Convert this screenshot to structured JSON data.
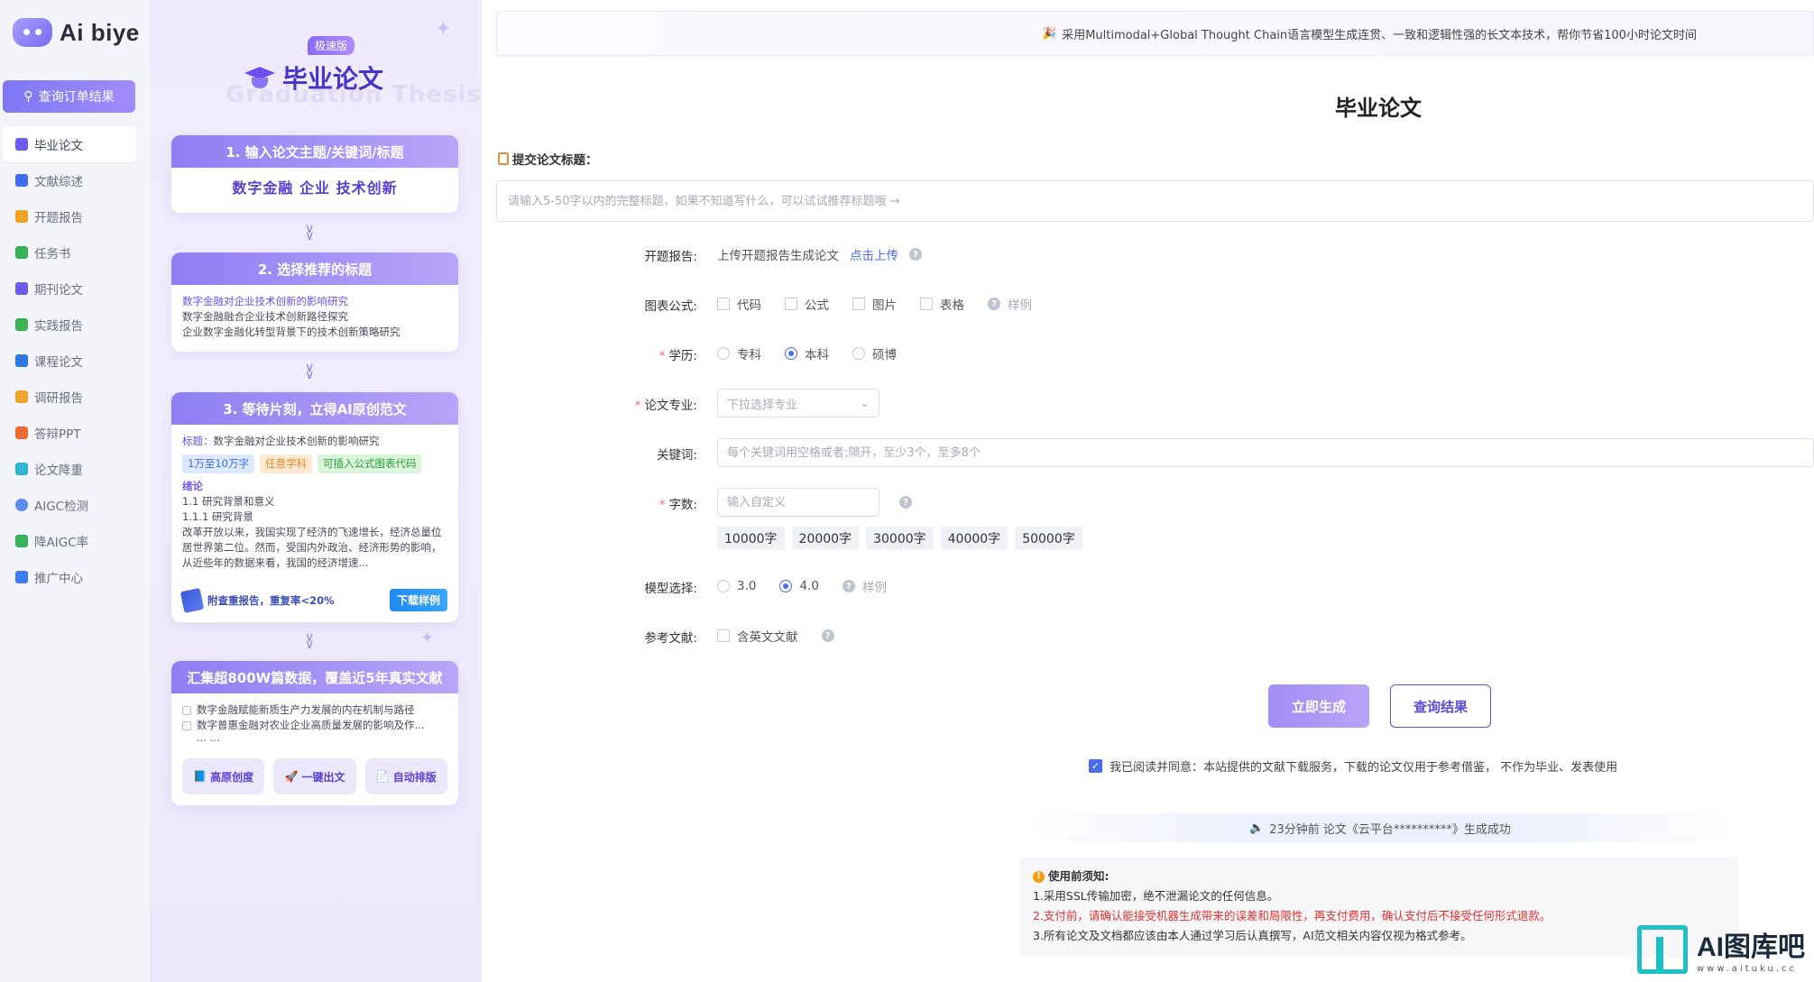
{
  "sidebar": {
    "logo": "Ai biye",
    "order_button": "查询订单结果",
    "items": [
      {
        "label": "毕业论文",
        "color": "#6a5cf0",
        "active": true
      },
      {
        "label": "文献综述",
        "color": "#3c6ff0"
      },
      {
        "label": "开题报告",
        "color": "#f3a21e"
      },
      {
        "label": "任务书",
        "color": "#33b45a"
      },
      {
        "label": "期刊论文",
        "color": "#6a5cf0"
      },
      {
        "label": "实践报告",
        "color": "#3bb552"
      },
      {
        "label": "课程论文",
        "color": "#2f77e0"
      },
      {
        "label": "调研报告",
        "color": "#f2a32b"
      },
      {
        "label": "答辩PPT",
        "color": "#f06a32"
      },
      {
        "label": "论文降重",
        "color": "#2fb6d6"
      },
      {
        "label": "AIGC检测",
        "color": "#5b8af0"
      },
      {
        "label": "降AIGC率",
        "color": "#33b45a"
      },
      {
        "label": "推广中心",
        "color": "#3c7ef0"
      }
    ]
  },
  "promo": {
    "badge": "极速版",
    "title": "毕业论文",
    "ghost": "Graduation Thesis",
    "step1": {
      "head": "1. 输入论文主题/关键词/标题",
      "body": "数字金融 企业 技术创新"
    },
    "step2": {
      "head": "2. 选择推荐的标题",
      "lines": [
        "数字金融对企业技术创新的影响研究",
        "数字金融融合企业技术创新路径探究",
        "企业数字金融化转型背景下的技术创新策略研究"
      ]
    },
    "step3": {
      "head": "3. 等待片刻，立得AI原创范文",
      "title_label": "标题：",
      "title_value": "数字金融对企业技术创新的影响研究",
      "tags": [
        "1万至10万字",
        "任意学科",
        "可插入公式图表代码"
      ],
      "section": "绪论",
      "outline": [
        "1.1 研究背景和意义",
        "1.1.1 研究背景"
      ],
      "paragraph": "改革开放以来，我国实现了经济的飞速增长，经济总量位居世界第二位。然而，受国内外政治、经济形势的影响，从近些年的数据来看，我国的经济增速...",
      "report_text": "附查重报告，重复率<20%",
      "download": "下载样例"
    },
    "step4": {
      "head": "汇集超800W篇数据，覆盖近5年真实文献",
      "items": [
        "数字金融赋能新质生产力发展的内在机制与路径",
        "数字普惠金融对农业企业高质量发展的影响及作..."
      ],
      "ellipsis": "... ...",
      "features": [
        "高原创度",
        "一键出文",
        "自动排版"
      ]
    }
  },
  "main": {
    "banner": "采用Multimodal+Global Thought Chain语言模型生成连贯、一致和逻辑性强的长文本技术，帮你节省100小时论文时间",
    "title": "毕业论文",
    "section_title": "提交论文标题：",
    "title_placeholder": "请输入5-50字以内的完整标题，如果不知道写什么，可以试试推荐标题哦 →",
    "proposal": {
      "label": "开题报告:",
      "text": "上传开题报告生成论文",
      "link": "点击上传"
    },
    "figures": {
      "label": "图表公式:",
      "options": [
        "代码",
        "公式",
        "图片",
        "表格"
      ],
      "sample": "样例"
    },
    "degree": {
      "label": "学历:",
      "options": [
        "专科",
        "本科",
        "硕博"
      ],
      "selected": 1
    },
    "major": {
      "label": "论文专业:",
      "placeholder": "下拉选择专业"
    },
    "keywords": {
      "label": "关键词:",
      "placeholder": "每个关键词用空格或者;隔开，至少3个，至多8个"
    },
    "wordcount": {
      "label": "字数:",
      "placeholder": "输入自定义",
      "chips": [
        "10000字",
        "20000字",
        "30000字",
        "40000字",
        "50000字"
      ]
    },
    "model": {
      "label": "模型选择:",
      "options": [
        "3.0",
        "4.0"
      ],
      "selected": 1,
      "sample": "样例"
    },
    "refs": {
      "label": "参考文献:",
      "option": "含英文文献"
    },
    "generate": "立即生成",
    "query": "查询结果",
    "agreement": "我已阅读并同意：本站提供的文献下载服务，下载的论文仅用于参考借鉴， 不作为毕业、发表使用",
    "ticker": "23分钟前 论文《云平台**********》生成成功",
    "notice": {
      "head": "使用前须知:",
      "lines": [
        "1.采用SSL传输加密，绝不泄漏论文的任何信息。",
        "2.支付前，请确认能接受机器生成带来的误差和局限性，再支付费用，确认支付后不接受任何形式退款。",
        "3.所有论文及文档都应该由本人通过学习后认真撰写，AI范文相关内容仅视为格式参考。"
      ]
    }
  },
  "watermark": {
    "big": "AI图库吧",
    "small": "www.aituku.cc"
  }
}
